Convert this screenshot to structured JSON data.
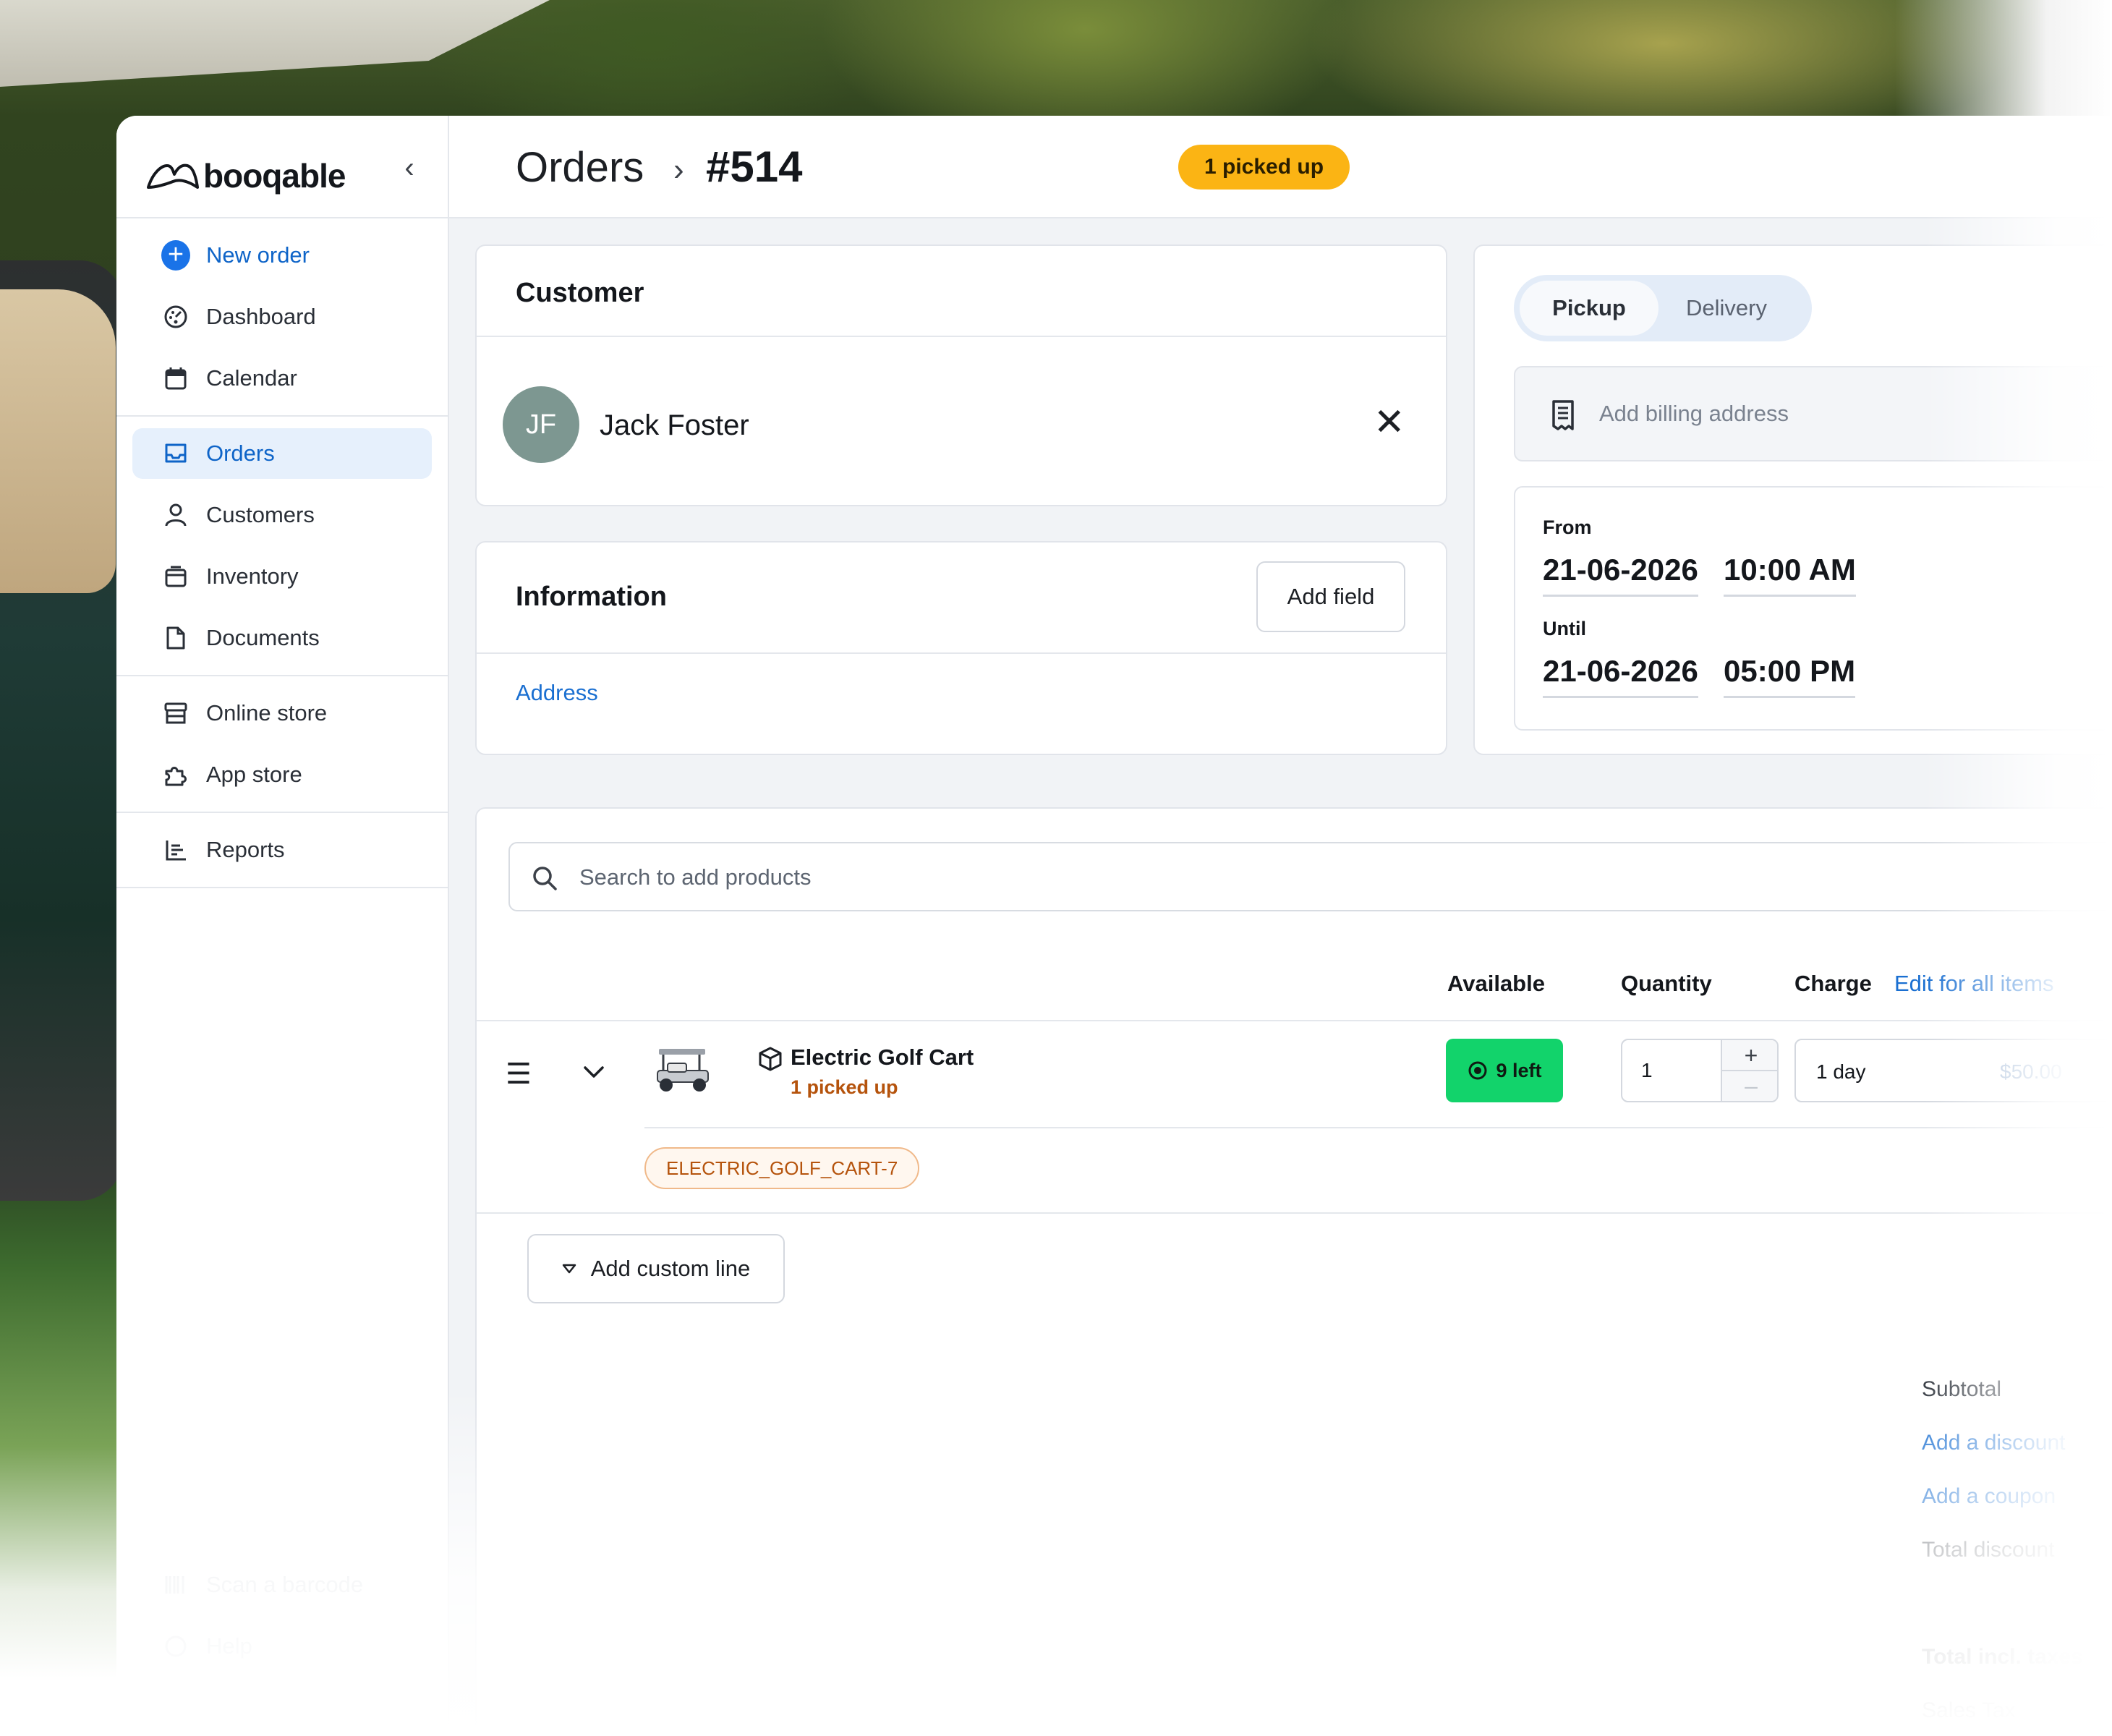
{
  "brand": {
    "name": "booqable"
  },
  "sidebar": {
    "collapse_glyph": "‹",
    "new_order": "New order",
    "group1": [
      {
        "label": "Dashboard",
        "icon": "dashboard-icon"
      },
      {
        "label": "Calendar",
        "icon": "calendar-icon"
      }
    ],
    "group2": [
      {
        "label": "Orders",
        "icon": "inbox-icon",
        "active": true
      },
      {
        "label": "Customers",
        "icon": "user-icon"
      },
      {
        "label": "Inventory",
        "icon": "box-icon"
      },
      {
        "label": "Documents",
        "icon": "document-icon"
      }
    ],
    "group3": [
      {
        "label": "Online store",
        "icon": "store-icon"
      },
      {
        "label": "App store",
        "icon": "puzzle-icon"
      }
    ],
    "group4": [
      {
        "label": "Reports",
        "icon": "chart-icon"
      }
    ],
    "bottom": [
      {
        "label": "Scan a barcode",
        "icon": "barcode-icon"
      },
      {
        "label": "Help",
        "icon": "help-icon"
      }
    ]
  },
  "header": {
    "breadcrumb_root": "Orders",
    "breadcrumb_sep": "›",
    "order_number": "#514",
    "status": "1 picked up",
    "status_color": "#fbb414"
  },
  "customer": {
    "title": "Customer",
    "initials": "JF",
    "name": "Jack Foster",
    "remove_glyph": "✕"
  },
  "information": {
    "title": "Information",
    "add_field": "Add field",
    "address_link": "Address"
  },
  "fulfillment": {
    "tabs": {
      "selected": "Pickup",
      "other": "Delivery"
    },
    "billing_placeholder": "Add billing address",
    "from_label": "From",
    "from_date": "21-06-2026",
    "from_time": "10:00 AM",
    "until_label": "Until",
    "until_date": "21-06-2026",
    "until_time": "05:00 PM"
  },
  "products": {
    "search_placeholder": "Search to add products",
    "columns": {
      "available": "Available",
      "quantity": "Quantity",
      "charge": "Charge",
      "edit_all": "Edit for all items"
    },
    "line": {
      "name": "Electric Golf Cart",
      "status": "1 picked up",
      "available": "9 left",
      "available_color": "#12d36b",
      "quantity": "1",
      "plus": "+",
      "minus": "–",
      "charge_period": "1 day",
      "charge_price": "$50.00",
      "identifier": "ELECTRIC_GOLF_CART-7"
    },
    "add_custom_line": "Add custom line"
  },
  "totals": {
    "subtotal": "Subtotal",
    "add_discount": "Add a discount",
    "add_coupon": "Add a coupon",
    "total_discount": "Total discount",
    "total_incl_taxes": "Total incl. taxes",
    "sales_tax": "Sales Tax"
  }
}
